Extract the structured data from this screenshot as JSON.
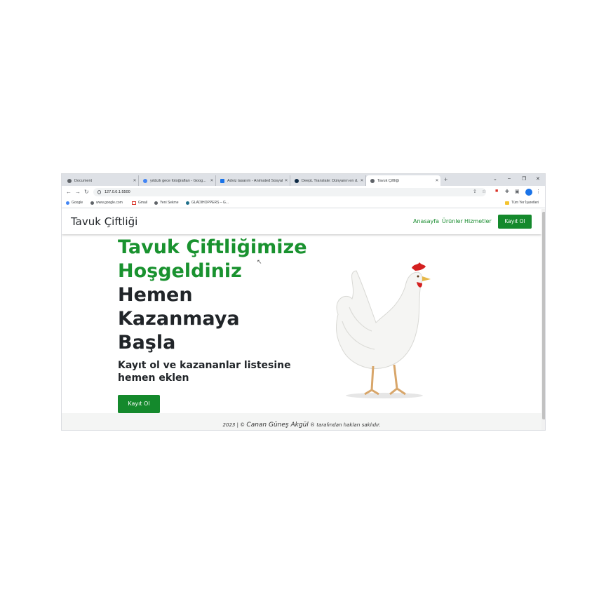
{
  "browser": {
    "tabs": [
      {
        "label": "Document"
      },
      {
        "label": "yıldızlı gece fotoğrafları - Goog..."
      },
      {
        "label": "Adviz tasarım - Animated Sosyal..."
      },
      {
        "label": "DeepL Translate: Dünyanın en d..."
      },
      {
        "label": "Tavuk Çiftliği"
      }
    ],
    "new_tab": "+",
    "url": "127.0.0.1:5500",
    "bookmarks": [
      {
        "label": "Google"
      },
      {
        "label": "www.google.com"
      },
      {
        "label": "Gmail"
      },
      {
        "label": "Yeni Sekme"
      },
      {
        "label": "GLADIHOPPERS – G..."
      }
    ],
    "all_bookmarks": "Tüm Yer İşaretleri"
  },
  "site": {
    "brand": "Tavuk Çiftliği",
    "nav": [
      {
        "label": "Anasayfa"
      },
      {
        "label": "Ürünler"
      },
      {
        "label": "Hizmetler"
      }
    ],
    "nav_button": "Kayıt Ol",
    "hero": {
      "title_green_1": "Tavuk Çiftliğimize",
      "title_green_2": "Hoşgeldiniz",
      "title_dark_1": "Hemen",
      "title_dark_2": "Kazanmaya",
      "title_dark_3": "Başla",
      "subtitle": "Kayıt ol ve kazananlar listesine hemen eklen",
      "cta": "Kayıt Ol"
    },
    "footer": {
      "prefix": "2023 | ©",
      "author": "Canan Güneş Akgül",
      "suffix": "® tarafından hakları saklıdır."
    }
  },
  "colors": {
    "accent_green": "#19922f",
    "button_green": "#14892c",
    "footer_bg": "#f4f5f4"
  }
}
